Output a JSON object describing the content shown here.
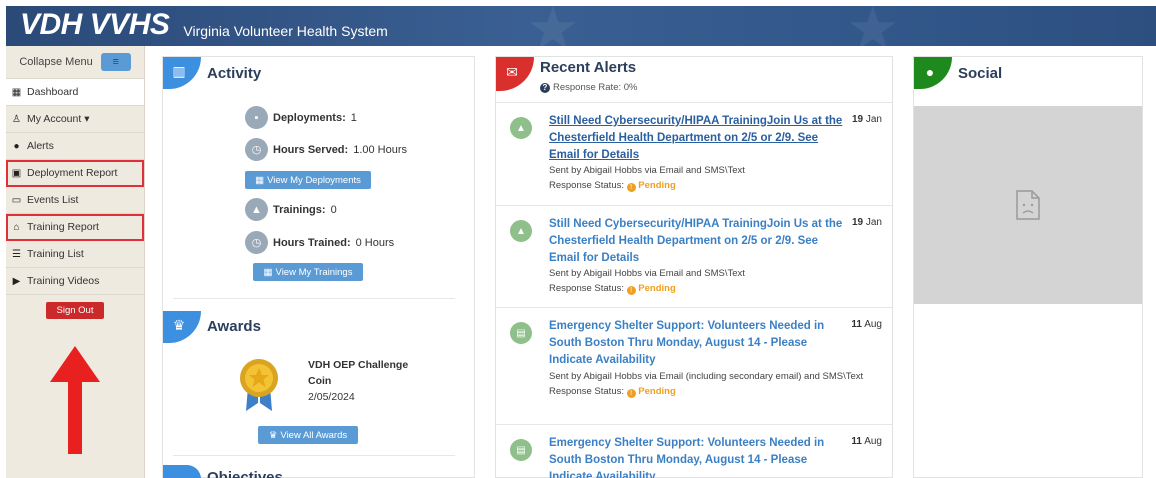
{
  "header": {
    "brand": "VDH VVHS",
    "subtitle": "Virginia Volunteer Health System"
  },
  "sidebar": {
    "collapse_label": "Collapse Menu",
    "items": [
      {
        "label": "Dashboard",
        "icon": "table-icon"
      },
      {
        "label": "My Account ▾",
        "icon": "user-icon"
      },
      {
        "label": "Alerts",
        "icon": "comment-icon"
      },
      {
        "label": "Deployment Report",
        "icon": "calendar-icon"
      },
      {
        "label": "Events List",
        "icon": "calendar-outline-icon"
      },
      {
        "label": "Training Report",
        "icon": "institution-icon"
      },
      {
        "label": "Training List",
        "icon": "list-icon"
      },
      {
        "label": "Training Videos",
        "icon": "video-icon"
      }
    ],
    "signout_label": "Sign Out"
  },
  "activity": {
    "title": "Activity",
    "deployments_label": "Deployments:",
    "deployments_value": "1",
    "hours_served_label": "Hours Served:",
    "hours_served_value": "1.00 Hours",
    "view_deployments": "View My Deployments",
    "trainings_label": "Trainings:",
    "trainings_value": "0",
    "hours_trained_label": "Hours Trained:",
    "hours_trained_value": "0 Hours",
    "view_trainings": "View My Trainings"
  },
  "awards": {
    "title": "Awards",
    "award_name_1": "VDH OEP Challenge",
    "award_name_2": "Coin",
    "award_date": "2/05/2024",
    "view_all": "View All Awards",
    "next_section": "Objectives"
  },
  "alerts": {
    "title": "Recent Alerts",
    "response_rate": "Response Rate: 0%",
    "items": [
      {
        "title": "Still Need Cybersecurity/HIPAA TrainingJoin Us at the Chesterfield Health Department on 2/5 or 2/9. See Email for Details",
        "day": "19",
        "month": "Jan",
        "sent": "Sent by Abigail Hobbs via Email and SMS\\Text",
        "status_label": "Response Status:",
        "status": "Pending"
      },
      {
        "title": "Still Need Cybersecurity/HIPAA TrainingJoin Us at the Chesterfield Health Department on 2/5 or 2/9. See Email for Details",
        "day": "19",
        "month": "Jan",
        "sent": "Sent by Abigail Hobbs via Email and SMS\\Text",
        "status_label": "Response Status:",
        "status": "Pending"
      },
      {
        "title": "Emergency Shelter Support: Volunteers Needed in South Boston Thru Monday, August 14 - Please Indicate Availability",
        "day": "11",
        "month": "Aug",
        "sent": "Sent by Abigail Hobbs via Email (including secondary email) and SMS\\Text",
        "status_label": "Response Status:",
        "status": "Pending"
      },
      {
        "title": "Emergency Shelter Support: Volunteers Needed in South Boston Thru Monday, August 14 - Please Indicate Availability",
        "day": "11",
        "month": "Aug"
      }
    ]
  },
  "social": {
    "title": "Social"
  },
  "colors": {
    "header": "#2b4a78",
    "accent_blue": "#5b9bd5",
    "alert_red": "#d9302e",
    "social_green": "#1e8a1e",
    "pending": "#f0a020",
    "highlight": "#e0303a"
  }
}
